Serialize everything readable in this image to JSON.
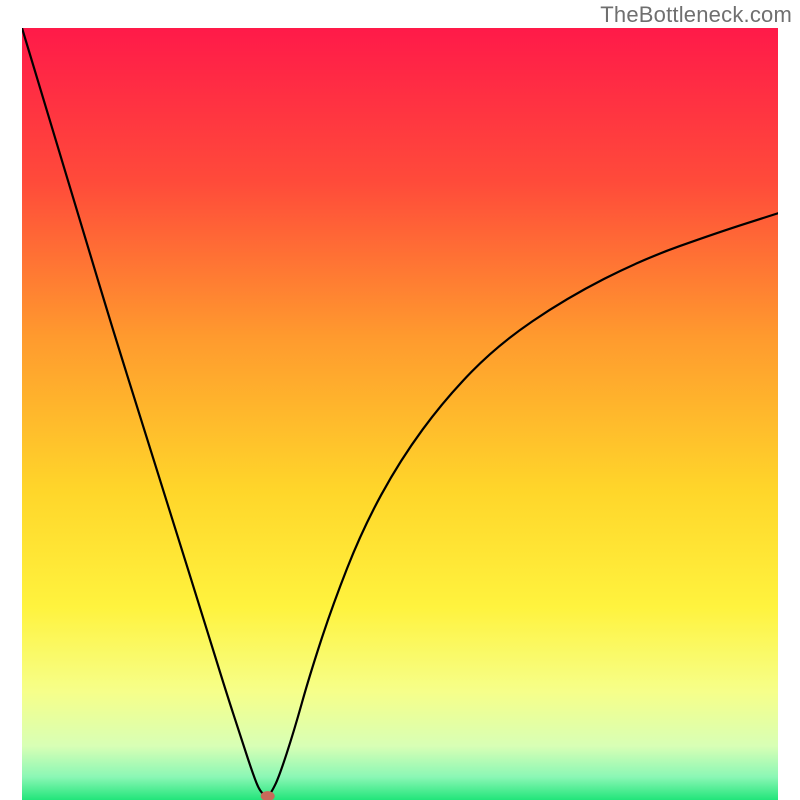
{
  "watermark": "TheBottleneck.com",
  "chart_data": {
    "type": "line",
    "title": "",
    "xlabel": "",
    "ylabel": "",
    "xlim": [
      0,
      100
    ],
    "ylim": [
      0,
      100
    ],
    "grid": false,
    "legend": false,
    "background": {
      "type": "vertical-gradient",
      "stops": [
        {
          "pos": 0.0,
          "color": "#ff1a49"
        },
        {
          "pos": 0.2,
          "color": "#ff4b3a"
        },
        {
          "pos": 0.4,
          "color": "#ff9a2e"
        },
        {
          "pos": 0.6,
          "color": "#ffd62a"
        },
        {
          "pos": 0.75,
          "color": "#fff33e"
        },
        {
          "pos": 0.86,
          "color": "#f6ff8a"
        },
        {
          "pos": 0.93,
          "color": "#d8ffb5"
        },
        {
          "pos": 0.97,
          "color": "#8bf7b5"
        },
        {
          "pos": 1.0,
          "color": "#22e57a"
        }
      ]
    },
    "series": [
      {
        "name": "bottleneck-curve",
        "color": "#000000",
        "x": [
          0.0,
          4.0,
          8.0,
          12.0,
          16.0,
          20.0,
          24.0,
          27.0,
          29.0,
          30.5,
          31.5,
          32.5,
          33.0,
          34.0,
          36.0,
          38.0,
          41.0,
          45.0,
          50.0,
          56.0,
          63.0,
          72.0,
          82.0,
          92.0,
          100.0
        ],
        "y": [
          100.0,
          87.0,
          74.0,
          61.0,
          48.5,
          36.0,
          23.5,
          14.0,
          8.0,
          3.5,
          1.0,
          0.5,
          1.0,
          3.0,
          9.0,
          16.0,
          25.0,
          35.0,
          44.0,
          52.0,
          59.0,
          65.0,
          70.0,
          73.5,
          76.0
        ]
      }
    ],
    "marker": {
      "name": "optimal-point",
      "x": 32.5,
      "y": 0.5,
      "color": "#c96a5a",
      "rx": 7,
      "ry": 5
    }
  }
}
